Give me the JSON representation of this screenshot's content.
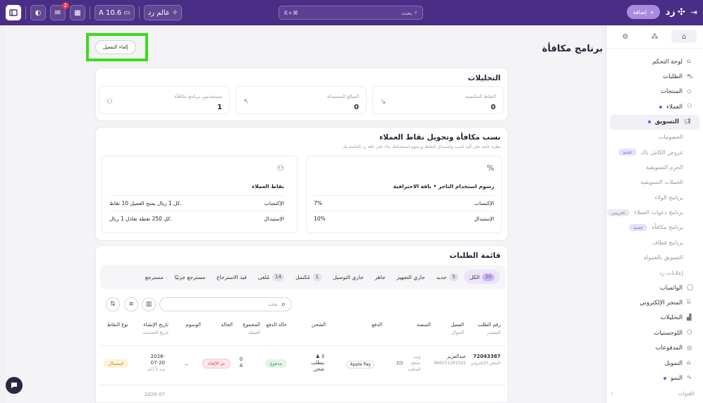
{
  "topbar": {
    "logo_text": "زد",
    "add_label": "إضافة",
    "search_placeholder": "بحث",
    "search_shortcut": "K+⌘",
    "store_label": "عالم رد",
    "version_label": "A 10.6",
    "notification_count": "2"
  },
  "sidebar": {
    "items": [
      {
        "label": "لوحة التحكم",
        "icon": "home-icon"
      },
      {
        "label": "الطلبات",
        "icon": "cart-icon"
      },
      {
        "label": "المنتجات",
        "icon": "tag-icon"
      },
      {
        "label": "العملاء",
        "icon": "users-icon"
      },
      {
        "label": "التسويق",
        "icon": "megaphone-icon"
      }
    ],
    "sub_items": [
      {
        "label": "الخصومات",
        "badge": ""
      },
      {
        "label": "عروض الكاش باك",
        "badge": "جديد"
      },
      {
        "label": "الحزم التسويقية",
        "badge": ""
      },
      {
        "label": "الحملات التسويقية",
        "badge": ""
      },
      {
        "label": "برنامج الولاء",
        "badge": ""
      },
      {
        "label": "برنامج دعوات العملاء",
        "badge": "تجريبي"
      },
      {
        "label": "برنامج مكافأة",
        "badge": "جديد"
      },
      {
        "label": "برنامج قطاف",
        "badge": ""
      },
      {
        "label": "التسويق بالعمولة",
        "badge": ""
      },
      {
        "label": "إعلانات زد",
        "badge": ""
      }
    ],
    "items2": [
      {
        "label": "الواتساب",
        "icon": "whatsapp-icon"
      },
      {
        "label": "المتجر الإلكتروني",
        "icon": "store-icon"
      },
      {
        "label": "التحليلات",
        "icon": "chart-icon"
      },
      {
        "label": "اللوجستيات",
        "icon": "truck-icon"
      },
      {
        "label": "المدفوعات",
        "icon": "card-icon"
      },
      {
        "label": "التمويل",
        "icon": "bank-icon"
      },
      {
        "label": "النمو",
        "icon": "growth-icon"
      }
    ],
    "footer_label": "القنوات"
  },
  "page": {
    "title": "برنامج مكافأة",
    "deactivate_label": "إلغاء التفعيل"
  },
  "analytics": {
    "title": "التحليلات",
    "stats": [
      {
        "label": "النقاط المكتسبة",
        "value": "0"
      },
      {
        "label": "المبالغ المستبدلة",
        "value": "0"
      },
      {
        "label": "مستخدمين برنامج مكافأة",
        "value": "1"
      }
    ]
  },
  "ratios": {
    "title": "نسب مكافأة وتحويل نقاط العملاء",
    "subtitle": "نظرة عامة على آلية كسب واستبدال النقاط ورسوم استخدامك بناء على باقة زد الخاصة بك",
    "merchant_card": {
      "title": "رسوم استخدام التاجر • باقة الاحترافية",
      "rows": [
        {
          "label": "الإكتساب",
          "value": "7%"
        },
        {
          "label": "الإستبدال",
          "value": "10%"
        }
      ]
    },
    "customer_card": {
      "title": "نقاط العملاء",
      "rows": [
        {
          "label": "الإكتساب",
          "value": "كل 1 ريال يمنح العميل 10 نقاط."
        },
        {
          "label": "الإستبدال",
          "value": "كل 250 نقطة تعادل 1 ريال."
        }
      ]
    }
  },
  "orders": {
    "title": "قائمة الطلبات",
    "filters": [
      {
        "label": "الكل",
        "count": "20"
      },
      {
        "label": "جديد",
        "count": "5"
      },
      {
        "label": "جاري التجهيز",
        "count": ""
      },
      {
        "label": "جاهز",
        "count": ""
      },
      {
        "label": "جاري التوصيل",
        "count": ""
      },
      {
        "label": "مُكتمل",
        "count": "1"
      },
      {
        "label": "مُلغى",
        "count": "14"
      },
      {
        "label": "قيد الاسترجاع",
        "count": ""
      },
      {
        "label": "مسترجع جزئيًا",
        "count": ""
      },
      {
        "label": "مسترجع",
        "count": ""
      }
    ],
    "search_placeholder": "بحث",
    "columns": [
      {
        "label": "رقم الطلب",
        "sub": "المصدر"
      },
      {
        "label": "العميل",
        "sub": "الجوال"
      },
      {
        "label": "المنصة",
        "sub": ""
      },
      {
        "label": "الدفع",
        "sub": ""
      },
      {
        "label": "الشحن",
        "sub": ""
      },
      {
        "label": "حالة الدفع",
        "sub": ""
      },
      {
        "label": "المجموع",
        "sub": "العملة"
      },
      {
        "label": "الحالة",
        "sub": ""
      },
      {
        "label": "الوسوم",
        "sub": ""
      },
      {
        "label": "تاريخ الإنشاء",
        "sub": "تاريخ التحديث"
      },
      {
        "label": "نوع النقاط",
        "sub": ""
      }
    ],
    "row": {
      "order_no": "72043387",
      "source": "المتجر الإلكتروني",
      "customer": "عبدالعزيز",
      "phone": "966551291022",
      "platform": "ويب سطح المكتب",
      "payment": "Apple Pay",
      "shipping": "لا يتطلب شحن",
      "payment_status": "مدفوع",
      "total": "0",
      "currency": "A",
      "status": "تم الإلغاء",
      "tags": "--",
      "created": "2026-07-20",
      "updated": "منذ 5 أيام",
      "points_type": "استبدال"
    },
    "next_row_date": "2026-07"
  }
}
